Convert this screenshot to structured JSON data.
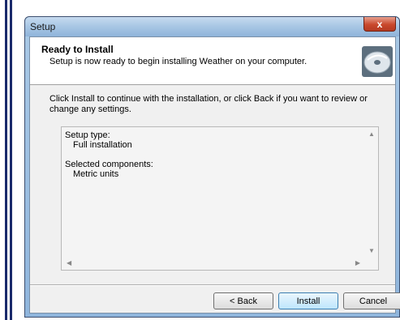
{
  "window": {
    "title": "Setup",
    "close_glyph": "x"
  },
  "header": {
    "title": "Ready to Install",
    "subtitle": "Setup is now ready to begin installing Weather on your computer.",
    "icon": "install-disc-icon"
  },
  "body": {
    "instructions": "Click Install to continue with the installation, or click Back if you want to review or change any settings."
  },
  "summary": {
    "setup_type_label": "Setup type:",
    "setup_type_value": "Full installation",
    "components_label": "Selected components:",
    "components_value": "Metric units"
  },
  "buttons": {
    "back": "< Back",
    "install": "Install",
    "cancel": "Cancel"
  },
  "colors": {
    "title_bar": "#a7c6e4",
    "close_button": "#c9482c",
    "default_button": "#bee6fd"
  }
}
